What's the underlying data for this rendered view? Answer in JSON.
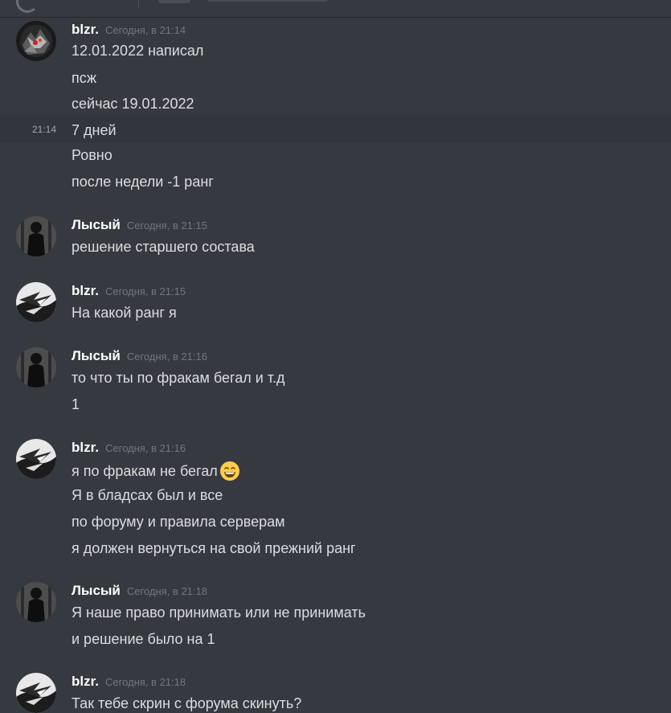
{
  "messages": [
    {
      "author": "blzr.",
      "author_color": "#ffffff",
      "timestamp": "Сегодня, в 21:14",
      "avatar": "blzr-avatar-red",
      "lines": [
        "12.01.2022 написал",
        "псж",
        "сейчас 19.01.2022",
        "7 дней",
        "Ровно",
        "после недели -1 ранг"
      ],
      "hover_line_index": 3,
      "hover_time": "21:14"
    },
    {
      "author": "Лысый",
      "author_color": "#ffffff",
      "timestamp": "Сегодня, в 21:15",
      "avatar": "lysyi-avatar",
      "lines": [
        "решение старшего состава"
      ]
    },
    {
      "author": "blzr.",
      "author_color": "#ffffff",
      "timestamp": "Сегодня, в 21:15",
      "avatar": "blzr-avatar-bw",
      "lines": [
        "На какой ранг я"
      ]
    },
    {
      "author": "Лысый",
      "author_color": "#ffffff",
      "timestamp": "Сегодня, в 21:16",
      "avatar": "lysyi-avatar",
      "lines": [
        "то что ты по фракам бегал и т.д",
        "1"
      ]
    },
    {
      "author": "blzr.",
      "author_color": "#ffffff",
      "timestamp": "Сегодня, в 21:16",
      "avatar": "blzr-avatar-bw",
      "lines": [
        "я по фракам не бегал",
        "Я в бладсах был и все",
        "по форуму и правила серверам",
        "я должен вернуться на свой прежний ранг"
      ],
      "emoji_after_line": 0,
      "emoji": "grinning-smiling-eyes-emoji"
    },
    {
      "author": "Лысый",
      "author_color": "#ffffff",
      "timestamp": "Сегодня, в 21:18",
      "avatar": "lysyi-avatar",
      "lines": [
        "Я наше право принимать или не принимать",
        "и решение было на 1"
      ]
    },
    {
      "author": "blzr.",
      "author_color": "#ffffff",
      "timestamp": "Сегодня, в 21:18",
      "avatar": "blzr-avatar-bw",
      "lines": [
        "Так тебе скрин с форума скинуть?"
      ]
    }
  ],
  "colors": {
    "background": "#36393f",
    "text": "#dcddde",
    "timestamp": "#72767d",
    "hover_row": "#32353b"
  }
}
